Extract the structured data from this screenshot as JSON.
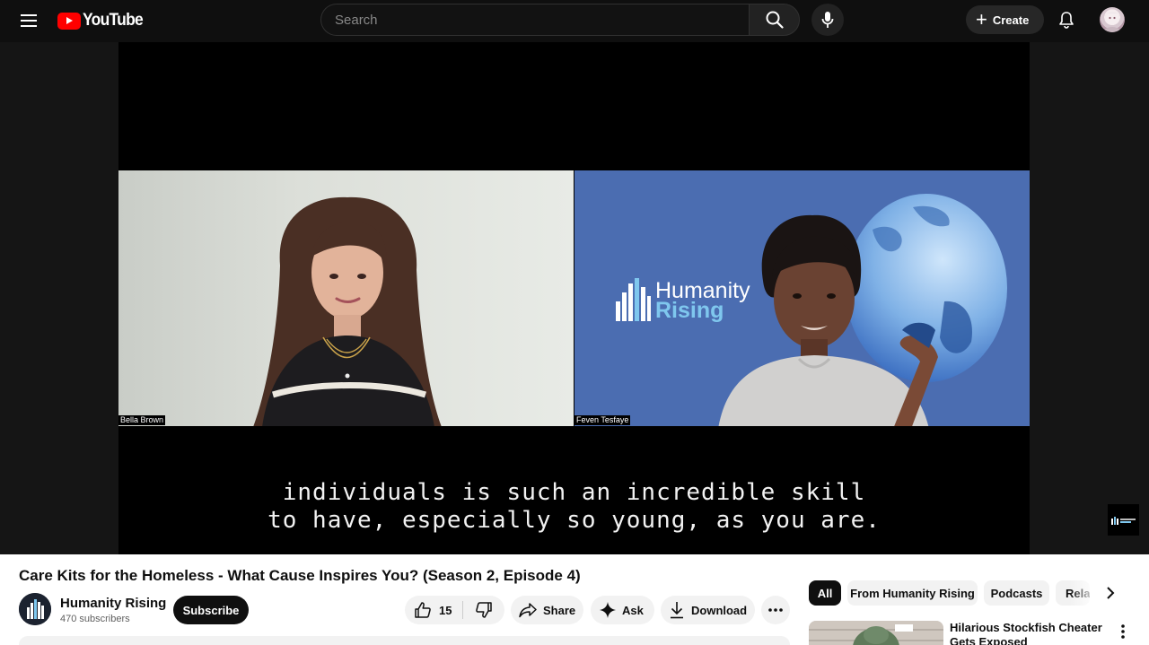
{
  "topbar": {
    "logo_text": "YouTube",
    "search_placeholder": "Search",
    "create_label": "Create"
  },
  "video": {
    "participants": [
      "Bella Brown",
      "Feven Tesfaye"
    ],
    "logo_lines": [
      "Humanity",
      "Rising"
    ],
    "caption_lines": [
      "individuals is such an incredible skill",
      "to have, especially so young, as you are."
    ]
  },
  "info": {
    "title": "Care Kits for the Homeless - What Cause Inspires You? (Season 2, Episode 4)",
    "channel_name": "Humanity Rising",
    "subscribers": "470 subscribers",
    "subscribe_label": "Subscribe",
    "like_count": "15",
    "share_label": "Share",
    "ask_label": "Ask",
    "download_label": "Download"
  },
  "chips": [
    "All",
    "From Humanity Rising",
    "Podcasts",
    "Rela"
  ],
  "recommendation": {
    "title": "Hilarious Stockfish Cheater Gets Exposed"
  },
  "colors": {
    "topbar_bg": "#0f0f0f",
    "brand_red": "#ff0000",
    "logo_blue": "#4b6db1",
    "logo_accent": "#7fc7ee"
  },
  "icons": [
    "menu-icon",
    "youtube-play-icon",
    "search-icon",
    "microphone-icon",
    "plus-icon",
    "bell-icon",
    "thumbs-up-icon",
    "thumbs-down-icon",
    "share-arrow-icon",
    "sparkle-icon",
    "download-icon",
    "more-horizontal-icon",
    "chevron-right-icon",
    "more-vertical-icon"
  ]
}
